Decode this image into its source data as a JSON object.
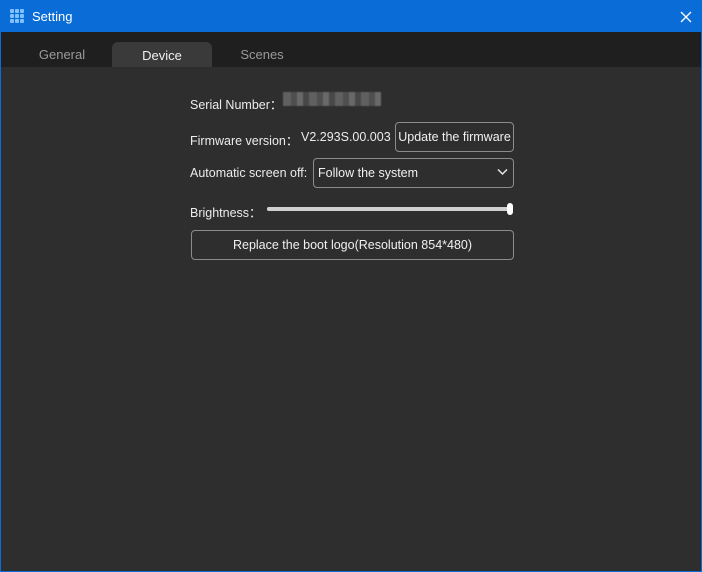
{
  "window": {
    "title": "Setting",
    "app_icon": "grid-app-icon",
    "close_icon": "close-icon"
  },
  "tabs": [
    {
      "label": "General",
      "active": false
    },
    {
      "label": "Device",
      "active": true
    },
    {
      "label": "Scenes",
      "active": false
    }
  ],
  "device": {
    "serial_label": "Serial Number：",
    "firmware_label": "Firmware version：",
    "firmware_value": "V2.293S.00.003",
    "update_button": "Update the firmware",
    "screen_off_label": "Automatic screen off:",
    "screen_off_value": "Follow the system",
    "brightness_label": "Brightness：",
    "brightness_level": 1.0,
    "replace_logo_button": "Replace the boot logo(Resolution 854*480)"
  },
  "colors": {
    "title_bar": "#0a6cd6",
    "background": "#2e2e2e",
    "tab_bar": "#1f1f1f"
  }
}
